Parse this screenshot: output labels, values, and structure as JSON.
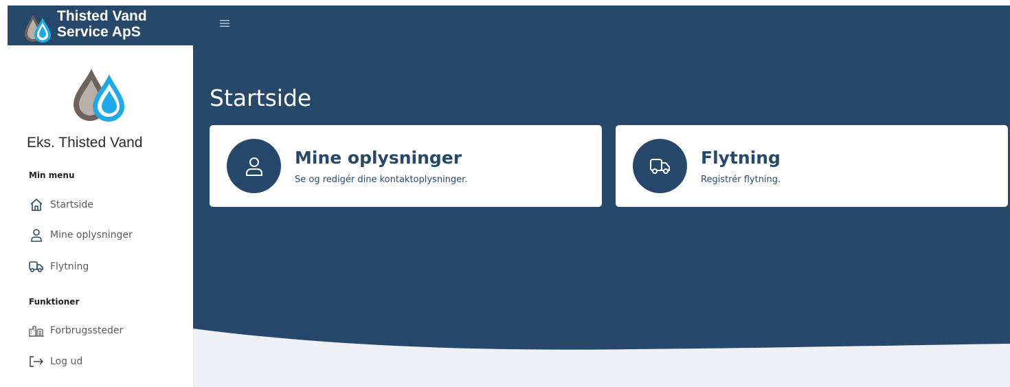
{
  "brand": {
    "name_line1": "Thisted Vand",
    "name_line2": "Service ApS"
  },
  "topbar": {
    "menu_icon": "hamburger-icon"
  },
  "sidebar": {
    "account_name": "Eks. Thisted Vand",
    "sections": [
      {
        "label": "Min menu",
        "items": [
          {
            "label": "Startside",
            "icon": "home-icon"
          },
          {
            "label": "Mine oplysninger",
            "icon": "user-icon"
          },
          {
            "label": "Flytning",
            "icon": "truck-icon"
          }
        ]
      },
      {
        "label": "Funktioner",
        "items": [
          {
            "label": "Forbrugssteder",
            "icon": "buildings-icon"
          },
          {
            "label": "Log ud",
            "icon": "logout-icon"
          }
        ]
      }
    ]
  },
  "main": {
    "title": "Startside",
    "cards": [
      {
        "title": "Mine oplysninger",
        "subtitle": "Se og redigér dine kontaktoplysninger.",
        "icon": "user-icon"
      },
      {
        "title": "Flytning",
        "subtitle": "Registrér flytning.",
        "icon": "truck-icon"
      }
    ]
  },
  "colors": {
    "primary": "#26486b",
    "background_light": "#eef0f5",
    "drop_dark": "#6e625a",
    "drop_light_blue": "#1fa9e8",
    "text_muted": "#5a5a5a"
  }
}
